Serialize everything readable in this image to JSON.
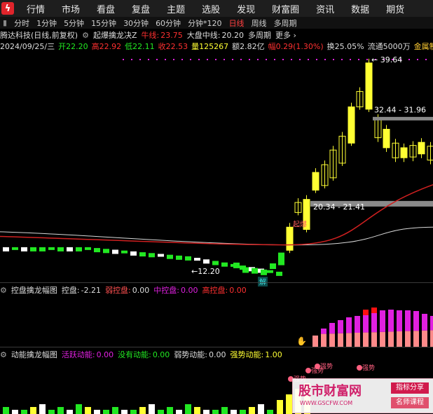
{
  "topnav": [
    "行情",
    "市场",
    "看盘",
    "复盘",
    "主题",
    "选股",
    "发现",
    "财富圈",
    "资讯",
    "数据",
    "期货"
  ],
  "periods": [
    "分时",
    "1分钟",
    "5分钟",
    "15分钟",
    "30分钟",
    "60分钟",
    "分钟*120",
    "日线",
    "周线",
    "多周期"
  ],
  "active_period": "日线",
  "header": {
    "stock": "腾达科技(日线,前复权)",
    "indicator": "起爆擒龙决Z",
    "bull_label": "牛线:",
    "bull_value": "23.75",
    "market_label": "大盘中线:",
    "market_value": "20.20",
    "more": "更多 ›"
  },
  "quote": {
    "date": "2024/09/25/三",
    "open": "开22.20",
    "high": "高22.92",
    "low": "低22.11",
    "close": "收22.53",
    "volume": "量125267",
    "amount": "额2.82亿",
    "range": "幅0.29(1.30%)",
    "turnover": "换25.05%",
    "float": "流通5000万",
    "sector": "金属制品"
  },
  "annotations": {
    "high": "39.64",
    "zone_upper": "32.44 - 31.96",
    "zone_lower": "20.34 - 21.41",
    "low": "12.20",
    "start": "起爆",
    "solve": "解"
  },
  "panel2": {
    "title": "控盘擒龙幅图",
    "k1": "控盘:",
    "v1": "-2.21",
    "k2": "弱控盘:",
    "v2": "0.00",
    "k3": "中控盘:",
    "v3": "0.00",
    "k4": "高控盘:",
    "v4": "0.00"
  },
  "panel3": {
    "title": "动能擒龙幅图",
    "k1": "活跃动能:",
    "v1": "0.00",
    "k2": "没有动能:",
    "v2": "0.00",
    "k3": "弱势动能:",
    "v3": "0.00",
    "k4": "强势动能:",
    "v4": "1.00",
    "tag": "强势"
  },
  "watermark": {
    "main": "股市财富网",
    "url": "WWW.GSCFW.COM",
    "tag1": "指标分享",
    "tag2": "名师课程"
  },
  "colors": {
    "up": "#ffff33",
    "down": "#22e822",
    "bull": "#ff2020",
    "magenta": "#e020e0",
    "pink": "#ff8a8a"
  }
}
